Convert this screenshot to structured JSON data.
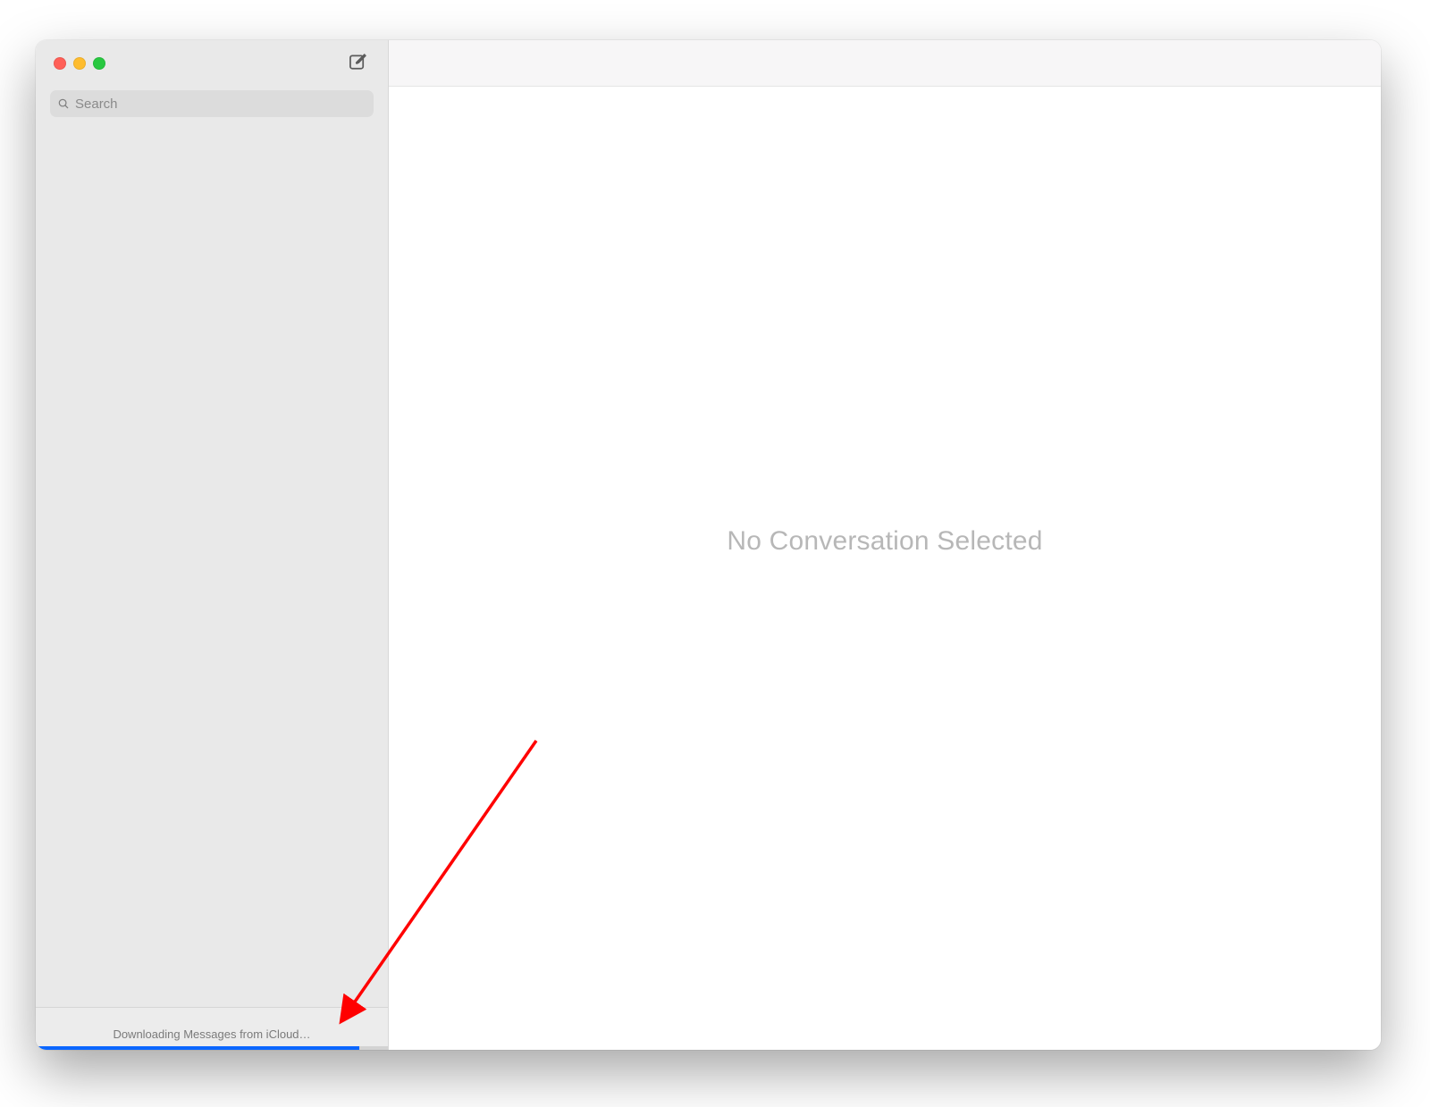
{
  "sidebar": {
    "search_placeholder": "Search",
    "footer_status": "Downloading Messages from iCloud…",
    "progress_percent": 92
  },
  "main": {
    "empty_state": "No Conversation Selected"
  },
  "colors": {
    "progress": "#0a66ff",
    "annotation": "#ff0000"
  }
}
